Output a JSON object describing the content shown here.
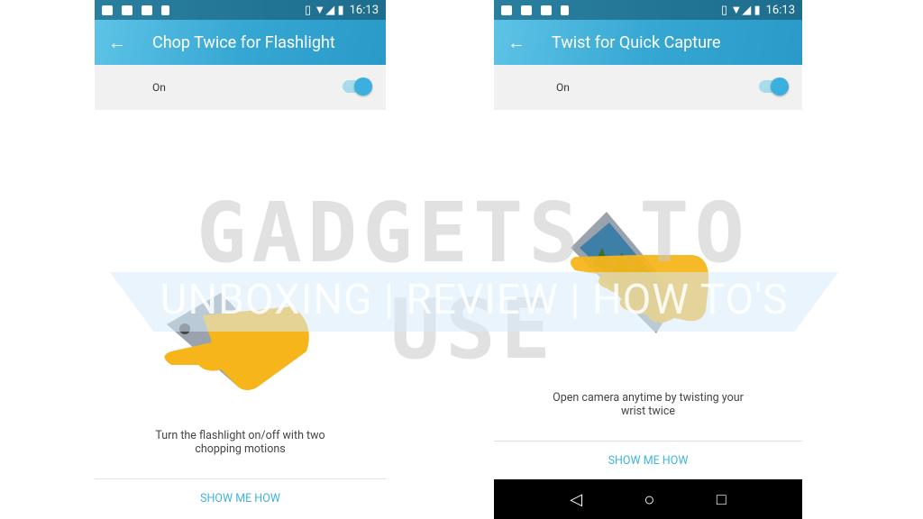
{
  "left_screen": {
    "status_bar": {
      "time": "16:13",
      "icons": [
        "owl-icon",
        "message-icon",
        "image-icon",
        "heart-icon",
        "phone-icon",
        "wifi-icon",
        "signal-icon",
        "battery-icon"
      ]
    },
    "title": "Chop Twice for Flashlight",
    "toggle": {
      "label": "On",
      "state": true
    },
    "description": "Turn the flashlight on/off with two chopping motions",
    "show_me_how": "SHOW ME HOW"
  },
  "right_screen": {
    "status_bar": {
      "time": "16:13"
    },
    "title": "Twist for Quick Capture",
    "toggle": {
      "label": "On",
      "state": true
    },
    "description": "Open camera anytime by twisting your wrist twice",
    "show_me_how": "SHOW ME HOW",
    "nav": [
      "back-icon",
      "home-icon",
      "recents-icon"
    ]
  },
  "watermark": {
    "line1": "GADGETS TO USE",
    "line2": "UNBOXING | REVIEW | HOW TO'S"
  },
  "colors": {
    "accent": "#3bb0de",
    "appbar": "#36a7d3",
    "hand": "#f6b51b"
  }
}
